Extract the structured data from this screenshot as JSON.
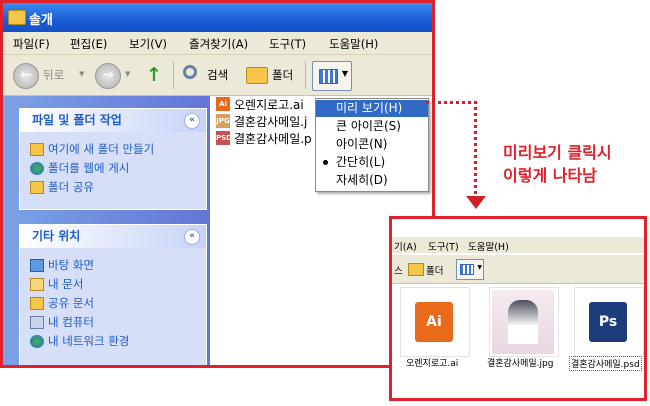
{
  "window": {
    "title": "솔개",
    "menu": [
      "파일(F)",
      "편집(E)",
      "보기(V)",
      "즐겨찾기(A)",
      "도구(T)",
      "도움말(H)"
    ],
    "toolbar": {
      "back": "뒤로",
      "search": "검색",
      "folders": "폴더"
    }
  },
  "tasks": {
    "file_folder": {
      "header": "파일 및 폴더 작업",
      "items": [
        "여기에 새 폴더 만들기",
        "폴더를 웹에 게시",
        "폴더 공유"
      ]
    },
    "other_places": {
      "header": "기타 위치",
      "items": [
        "바탕 화면",
        "내 문서",
        "공유 문서",
        "내 컴퓨터",
        "내 네트워크 환경"
      ]
    }
  },
  "files": [
    "오렌지로고.ai",
    "결혼감사메일.j",
    "결혼감사메일.p"
  ],
  "view_menu": {
    "items": [
      "미리 보기(H)",
      "큰 아이콘(S)",
      "아이콘(N)",
      "간단히(L)",
      "자세히(D)"
    ],
    "highlighted": "미리 보기(H)",
    "selected": "간단히(L)"
  },
  "callout": {
    "line1": "미리보기 클릭시",
    "line2": "이렇게 나타남"
  },
  "zoom": {
    "menu": [
      "기(A)",
      "도구(T)",
      "도움말(H)"
    ],
    "toolbar": {
      "folders": "폴더"
    },
    "thumbnails": [
      "오렌지로고.ai",
      "결혼감사메일.jpg",
      "결혼감사메일.psd"
    ],
    "ai_badge": "Ai",
    "ps_badge": "Ps"
  },
  "colors": {
    "accent": "#e0202a",
    "title_bar": "#1b5ed8",
    "menu_highlight": "#316ac5",
    "task_pane": "#6f8fe0"
  }
}
